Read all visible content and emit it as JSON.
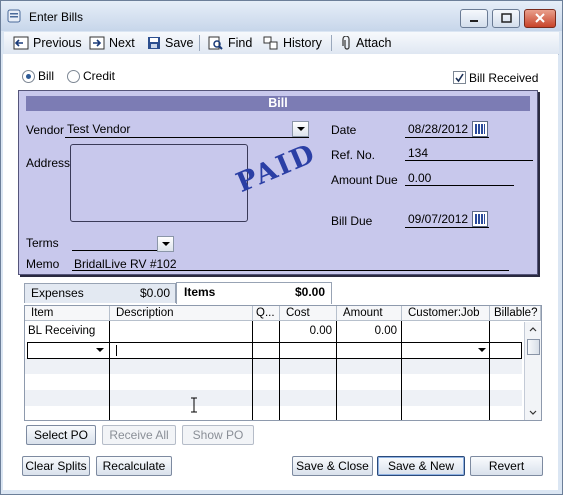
{
  "window": {
    "title": "Enter Bills"
  },
  "toolbar": {
    "previous": "Previous",
    "next": "Next",
    "save": "Save",
    "find": "Find",
    "history": "History",
    "attach": "Attach"
  },
  "mode": {
    "bill_label": "Bill",
    "credit_label": "Credit",
    "bill_received_label": "Bill Received"
  },
  "bill": {
    "header": "Bill",
    "vendor_label": "Vendor",
    "vendor_value": "Test Vendor",
    "address_label": "Address",
    "date_label": "Date",
    "date_value": "08/28/2012",
    "ref_label": "Ref. No.",
    "ref_value": "134",
    "amount_due_label": "Amount Due",
    "amount_due_value": "0.00",
    "bill_due_label": "Bill Due",
    "bill_due_value": "09/07/2012",
    "terms_label": "Terms",
    "memo_label": "Memo",
    "memo_value": "BridalLive RV #102",
    "stamp": "PAID"
  },
  "tabs": [
    {
      "label": "Expenses",
      "amount": "$0.00"
    },
    {
      "label": "Items",
      "amount": "$0.00"
    }
  ],
  "grid": {
    "columns": [
      "Item",
      "Description",
      "Q...",
      "Cost",
      "Amount",
      "Customer:Job",
      "Billable?"
    ],
    "rows": [
      {
        "item": "BL Receiving",
        "description": "",
        "qty": "",
        "cost": "0.00",
        "amount": "0.00",
        "customer": "",
        "billable": ""
      }
    ]
  },
  "grid_buttons": {
    "select_po": "Select PO",
    "receive_all": "Receive All",
    "show_po": "Show PO"
  },
  "footer": {
    "clear_splits": "Clear Splits",
    "recalculate": "Recalculate",
    "save_close": "Save & Close",
    "save_new": "Save & New",
    "revert": "Revert"
  }
}
